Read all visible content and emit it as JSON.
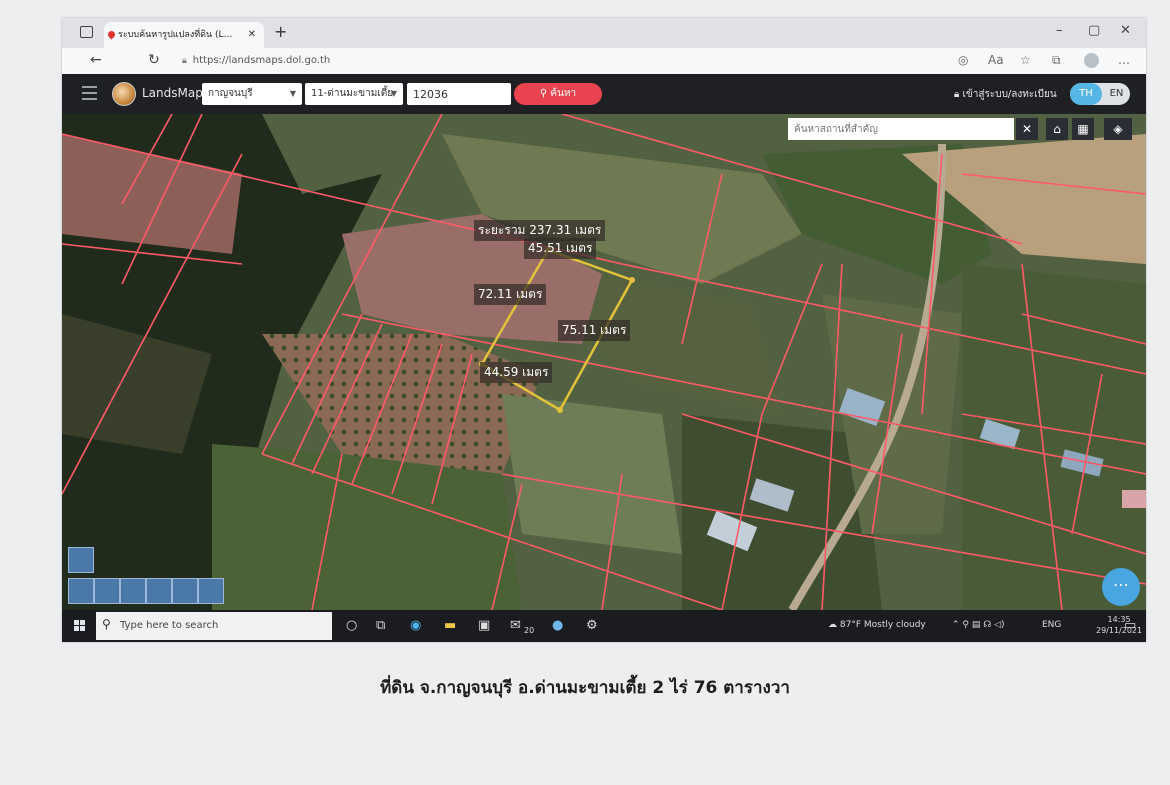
{
  "browser": {
    "tab_title": "ระบบค้นหารูปแปลงที่ดิน (LandsMap",
    "url": "https://landsmaps.dol.go.th"
  },
  "app": {
    "brand": "LandsMaps",
    "province": "กาญจนบุรี",
    "district": "11-ด่านมะขามเตี้ย",
    "parcel_no": "12036",
    "search_label": "ค้นหา",
    "login_label": "เข้าสู่ระบบ/ลงทะเบียน",
    "lang_th": "TH",
    "lang_en": "EN"
  },
  "map": {
    "search_placeholder": "ค้นหาสถานที่สำคัญ",
    "total_distance": "ระยะรวม 237.31 เมตร",
    "side_top": "45.51 เมตร",
    "side_left": "72.11 เมตร",
    "side_right": "75.11 เมตร",
    "side_bottom": "44.59 เมตร",
    "parcel_color": "#e3c23b",
    "boundary_color": "#ff5a68"
  },
  "taskbar": {
    "search_placeholder": "Type here to search",
    "badge": "20",
    "weather": "87°F  Mostly cloudy",
    "lang": "ENG",
    "time": "14:35",
    "date": "29/11/2021"
  },
  "caption": "ที่ดิน จ.กาญจนบุรี อ.ด่านมะขามเตี้ย 2 ไร่ 76 ตารางวา"
}
